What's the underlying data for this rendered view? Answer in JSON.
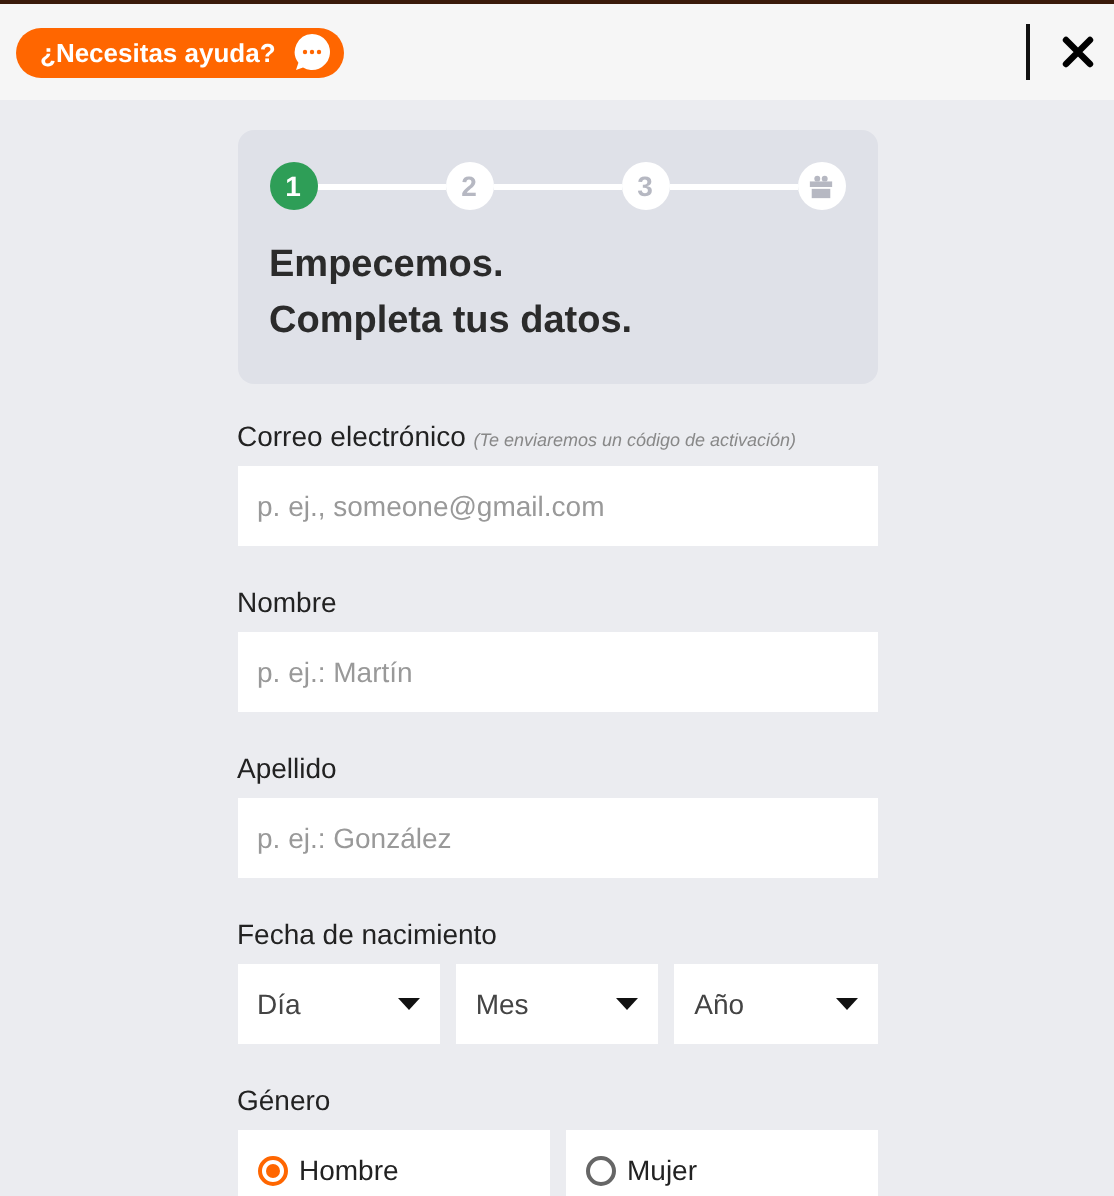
{
  "help_button": {
    "label": "¿Necesitas ayuda?"
  },
  "steps": [
    {
      "kind": "number",
      "label": "1",
      "active": true
    },
    {
      "kind": "number",
      "label": "2",
      "active": false
    },
    {
      "kind": "number",
      "label": "3",
      "active": false
    },
    {
      "kind": "gift",
      "active": false
    }
  ],
  "heading": [
    "Empecemos.",
    "Completa tus datos."
  ],
  "fields": [
    {
      "label": "Correo electrónico",
      "hint": "(Te enviaremos un código de activación)",
      "placeholder": "p. ej., someone@gmail.com"
    },
    {
      "label": "Nombre",
      "placeholder": "p. ej.: Martín"
    },
    {
      "label": "Apellido",
      "placeholder": "p. ej.: González"
    }
  ],
  "birthdate": {
    "label": "Fecha de nacimiento",
    "selects": [
      "Día",
      "Mes",
      "Año"
    ]
  },
  "gender": {
    "label": "Género",
    "options": [
      {
        "label": "Hombre",
        "selected": true
      },
      {
        "label": "Mujer",
        "selected": false
      }
    ]
  }
}
